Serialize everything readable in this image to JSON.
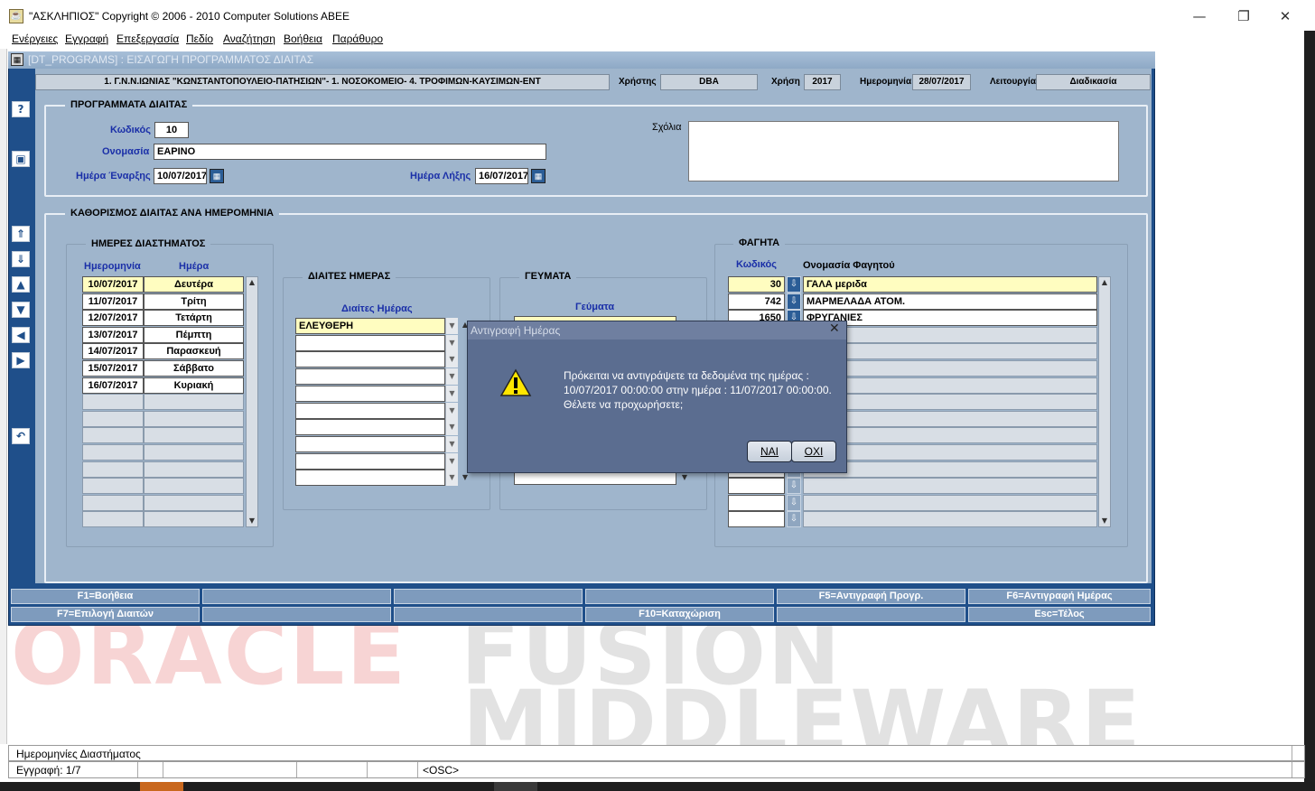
{
  "window": {
    "title": "\"ΑΣΚΛΗΠΙΟΣ\" Copyright © 2006 - 2010 Computer Solutions ABEE",
    "app_icon": "java-cup-icon",
    "minimize": "—",
    "restore": "❐",
    "close": "✕"
  },
  "menu": [
    "Ενέργειες",
    "Εγγραφή",
    "Επεξεργασία",
    "Πεδίο",
    "Αναζήτηση",
    "Βοήθεια",
    "Παράθυρο"
  ],
  "form": {
    "title": "[DT_PROGRAMS]  :  ΕΙΣΑΓΩΓΗ ΠΡΟΓΡΑΜΜΑΤΟΣ ΔΙΑΙΤΑΣ",
    "header": {
      "organization": "1. Γ.Ν.Ν.ΙΩΝΙΑΣ \"ΚΩΝΣΤΑΝΤΟΠΟΥΛΕΙΟ-ΠΑΤΗΣΙΩΝ\"- 1. ΝΟΣΟΚΟΜΕΙΟ- 4. ΤΡΟΦΙΜΩΝ-ΚΑΥΣΙΜΩΝ-ΕΝΤ",
      "user_label": "Χρήστης",
      "user": "DBA",
      "year_label": "Χρήση",
      "year": "2017",
      "date_label": "Ημερομηνία",
      "date": "28/07/2017",
      "function_label": "Λειτουργία",
      "function": "Διαδικασία"
    },
    "program": {
      "legend": "ΠΡΟΓΡΑΜΜΑΤΑ ΔΙΑΙΤΑΣ",
      "code_label": "Κωδικός",
      "code": "10",
      "name_label": "Ονομασία",
      "name": "ΕΑΡΙΝΟ",
      "start_label": "Ημέρα Έναρξης",
      "start": "10/07/2017",
      "end_label": "Ημέρα Λήξης",
      "end": "16/07/2017",
      "comments_label": "Σχόλια",
      "comments": ""
    },
    "diet_def": {
      "legend": "ΚΑΘΟΡΙΣΜΟΣ ΔΙΑΙΤΑΣ ΑΝΑ ΗΜΕΡΟΜΗΝΙΑ",
      "days": {
        "legend": "ΗΜΕΡΕΣ ΔΙΑΣΤΗΜΑΤΟΣ",
        "col_date": "Ημερομηνία",
        "col_day": "Ημέρα",
        "rows": [
          {
            "date": "10/07/2017",
            "day": "Δευτέρα"
          },
          {
            "date": "11/07/2017",
            "day": "Τρίτη"
          },
          {
            "date": "12/07/2017",
            "day": "Τετάρτη"
          },
          {
            "date": "13/07/2017",
            "day": "Πέμπτη"
          },
          {
            "date": "14/07/2017",
            "day": "Παρασκευή"
          },
          {
            "date": "15/07/2017",
            "day": "Σάββατο"
          },
          {
            "date": "16/07/2017",
            "day": "Κυριακή"
          }
        ]
      },
      "diets": {
        "legend": "ΔΙΑΙΤΕΣ ΗΜΕΡΑΣ",
        "col": "Διαίτες Ημέρας",
        "rows": [
          "ΕΛΕΥΘΕΡΗ"
        ]
      },
      "meals": {
        "legend": "ΓΕΥΜΑΤΑ",
        "col": "Γεύματα"
      },
      "foods": {
        "legend": "ΦΑΓΗΤΑ",
        "col_code": "Κωδικός",
        "col_name": "Ονομασία Φαγητού",
        "rows": [
          {
            "code": "30",
            "name": "ΓΑΛΑ μεριδα"
          },
          {
            "code": "742",
            "name": "ΜΑΡΜΕΛΑΔΑ ΑΤΟΜ."
          },
          {
            "code": "1650",
            "name": "ΦΡΥΓΑΝΙΕΣ"
          }
        ]
      }
    },
    "fkeys_row1": [
      "F1=Βοήθεια",
      "",
      "",
      "",
      "F5=Αντιγραφή Προγρ.",
      "F6=Αντιγραφή Ημέρας"
    ],
    "fkeys_row2": [
      "F7=Επιλογή Διαιτών",
      "",
      "",
      "F10=Καταχώριση",
      "",
      "Esc=Τέλος"
    ]
  },
  "watermark": {
    "line1a": "ORACLE",
    "line1b": "FUSION",
    "line2": "MIDDLEWARE"
  },
  "dialog": {
    "title": "Αντιγραφή Ημέρας",
    "icon": "warning-icon",
    "line1": "Πρόκειται να αντιγράψετε τα δεδομένα της ημέρας :",
    "line2": "10/07/2017 00:00:00 στην ημέρα : 11/07/2017 00:00:00.",
    "line3": "Θέλετε να προχωρήσετε;",
    "yes": "ΝΑΙ",
    "no": "ΟΧΙ"
  },
  "status": {
    "field_hint": "Ημερομηνίες Διαστήματος",
    "record": "Εγγραφή: 1/7",
    "mode": "<OSC>"
  }
}
